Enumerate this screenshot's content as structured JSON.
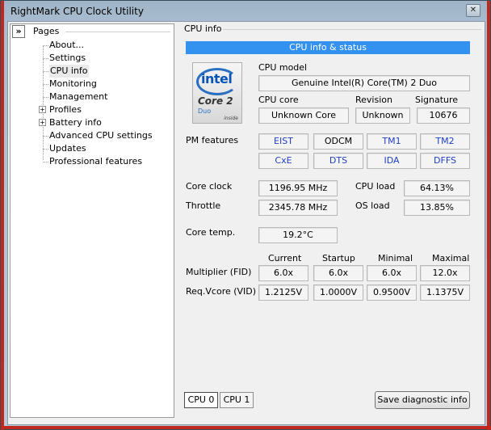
{
  "window": {
    "title": "RightMark CPU Clock Utility",
    "close_glyph": "✕"
  },
  "sidebar": {
    "collapse_glyph": "»",
    "title": "Pages",
    "items": [
      {
        "label": "About..."
      },
      {
        "label": "Settings"
      },
      {
        "label": "CPU info"
      },
      {
        "label": "Monitoring"
      },
      {
        "label": "Management"
      },
      {
        "label": "Profiles"
      },
      {
        "label": "Battery info"
      },
      {
        "label": "Advanced CPU settings"
      },
      {
        "label": "Updates"
      },
      {
        "label": "Professional features"
      }
    ],
    "selected": "CPU info",
    "expander_glyph": "+"
  },
  "main": {
    "section_title": "CPU info",
    "banner": "CPU info & status",
    "logo": {
      "brand": "intel",
      "line": "Core 2",
      "sub": "Duo",
      "inside": "inside"
    },
    "cpu_model_label": "CPU model",
    "cpu_model_value": "Genuine Intel(R) Core(TM) 2 Duo",
    "cpu_core_label": "CPU core",
    "cpu_core_value": "Unknown Core",
    "revision_label": "Revision",
    "revision_value": "Unknown",
    "signature_label": "Signature",
    "signature_value": "10676",
    "pm_features_label": "PM features",
    "pm_features": [
      {
        "label": "EIST",
        "active": true
      },
      {
        "label": "ODCM",
        "active": false
      },
      {
        "label": "TM1",
        "active": true
      },
      {
        "label": "TM2",
        "active": true
      },
      {
        "label": "CxE",
        "active": true
      },
      {
        "label": "DTS",
        "active": true
      },
      {
        "label": "IDA",
        "active": true
      },
      {
        "label": "DFFS",
        "active": true
      }
    ],
    "core_clock_label": "Core clock",
    "core_clock_value": "1196.95 MHz",
    "throttle_label": "Throttle",
    "throttle_value": "2345.78 MHz",
    "cpu_load_label": "CPU load",
    "cpu_load_value": "64.13%",
    "os_load_label": "OS load",
    "os_load_value": "13.85%",
    "core_temp_label": "Core temp.",
    "core_temp_value": "19.2°C",
    "table": {
      "columns": [
        "Current",
        "Startup",
        "Minimal",
        "Maximal"
      ],
      "rows": [
        {
          "label": "Multiplier (FID)",
          "values": [
            "6.0x",
            "6.0x",
            "6.0x",
            "12.0x"
          ]
        },
        {
          "label": "Req.Vcore (VID)",
          "values": [
            "1.2125V",
            "1.0000V",
            "0.9500V",
            "1.1375V"
          ]
        }
      ]
    },
    "tabs": [
      {
        "label": "CPU 0"
      },
      {
        "label": "CPU 1"
      }
    ],
    "active_tab": "CPU 0",
    "save_button": "Save diagnostic info"
  }
}
